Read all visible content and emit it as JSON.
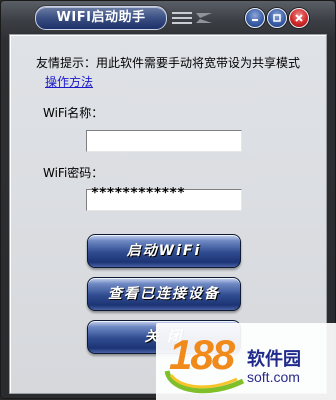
{
  "window": {
    "title": "WIFI启动助手",
    "controls": {
      "minimize_icon": "minimize-icon",
      "maximize_icon": "maximize-icon",
      "close_icon": "close-icon"
    }
  },
  "form": {
    "tip": "友情提示：用此软件需要手动将宽带设为共享模式",
    "method_link": "操作方法",
    "ssid_label": "WiFi名称：",
    "ssid_value": "",
    "password_label": "WiFi密码：",
    "password_mask": "************"
  },
  "buttons": {
    "start": "启动WiFi",
    "view_devices": "查看已连接设备",
    "close_partial": "关 闭"
  },
  "watermark": {
    "logo_number": "188",
    "site_name": "软件园",
    "url": "soft.com"
  },
  "colors": {
    "title_pill": "#3a4f83",
    "button": "#2f4b8f",
    "close_button": "#d22b2b",
    "link": "#1a1acc",
    "watermark_orange": "#f08a1a",
    "watermark_blue": "#1f2a8c"
  }
}
